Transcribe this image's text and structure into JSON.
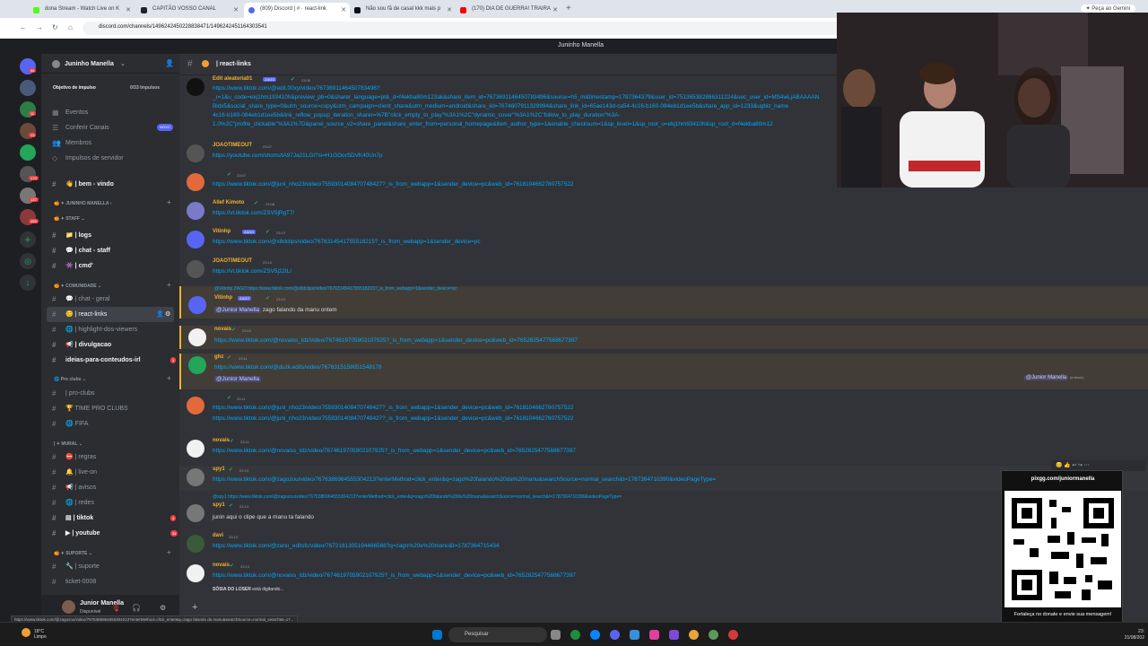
{
  "browser": {
    "tabs": [
      {
        "label": "dona Stream - Watch Live on K",
        "color": "#53fc18"
      },
      {
        "label": "CAPITÃO VOSSO CANAL",
        "color": "#222222"
      },
      {
        "label": "(809) Discord | # · react-link",
        "color": "#5865f2"
      },
      {
        "label": "Não sou fã de casal kkk mais p",
        "color": "#111111"
      },
      {
        "label": "(170) DIA DE GUERRA! TRAIRA",
        "color": "#ff0000"
      }
    ],
    "url": "discord.com/channels/1496242450228838471/1496242451164303541",
    "gemini_label": "Peça ao Gemini"
  },
  "window_title": "Juninho Manella",
  "sidebar": {
    "server_name": "Juninho Manella",
    "boost_label": "Objetivo de impulso",
    "boost_count": "0/33 Impulsos",
    "top_items": [
      {
        "label": "Eventos",
        "icon": "calendar-icon"
      },
      {
        "label": "Conferir Canais",
        "icon": "browse-icon",
        "badge": "NOVO"
      },
      {
        "label": "Membros",
        "icon": "members-icon"
      },
      {
        "label": "Impulsos de servidor",
        "icon": "boost-icon"
      }
    ],
    "categories": [
      "JUNINHO MANELLA",
      "STAFF",
      "COMUNIDADE",
      "Pro clubs",
      "MURAL",
      "SUPORTE"
    ],
    "channels": [
      "| bem - vindo",
      "| logs",
      "| chat - staff",
      "| cmd'",
      "| chat - geral",
      "| react-links",
      "| highlight-dos-viewers",
      "| divulgacao",
      "ideias-para-conteudos-irl",
      "| pro-clubs",
      "TIME PRO CLUBS",
      "FIFA",
      "| regras",
      "| live-on",
      "| avisos",
      "| redes",
      "| tiktok",
      "| youtube",
      "| suporte",
      "ticket-0008"
    ],
    "badges": {
      "ideias": "1",
      "tiktok": "1",
      "youtube": "11"
    }
  },
  "guild_badges": [
    "86",
    "11",
    "13",
    "179",
    "137",
    "459"
  ],
  "user": {
    "name": "Junior Manella",
    "status": "Disponível"
  },
  "channel": {
    "name": "| react-links"
  },
  "messages": [
    {
      "author": "Edit aleatoria01",
      "tag": "ZAGO",
      "time": "23:06",
      "color": "#f0b232",
      "lines": [
        "https://www.tiktok.com/@edit.00xy/video/7673691146450783496?",
        "_r=1&u_code=ekj1hm193410h&preview_pb=0&sharer_language=pt&_d=f4ekba80m123ak&share_item_id=7673691146450783496&source=h5_m&timestamp=1787364379&user_id=751365382886311224&sec_user_id=MS4wLjABAAAAN",
        "Bidx5&social_share_type=0&utm_source=copy&utm_campaign=client_share&utm_medium=android&share_iid=7674607911329994&share_link_id=65ae143d-ca54-4c16-b160-084eb1d1ee5b&share_app_id=1233&ugbiz_name",
        "4c16-b160-084eb1d1ee5b&link_reflow_popup_iteration_sharer=%7B\"click_empty_to_play\"%3A1%2C\"dynamic_cover\"%3A1%2C\"follow_to_play_duration\"%3A-",
        "1.0%2C\"profile_clickable\"%3A1%7D&panel_source_v2=share_panel&share_enter_from=personal_homepage&item_author_type=1&enable_checksum=1&sp_level=1&sp_root_u=ekj1hm93410h&sp_root_d=f4ekba80m12"
      ]
    },
    {
      "author": "JOAOTIMEOUT",
      "time": "23:07",
      "color": "#f0b232",
      "lines": [
        "https://youtube.com/shorts/tA97Ja21LGI?si=H1GOorSDVK40Un7p"
      ]
    },
    {
      "author": "",
      "time": "23:07",
      "color": "#dbdee1",
      "lines": [
        "https://www.tiktok.com/@juni_nho23/video/7559301408470748427?_is_from_webapp=1&sender_device=pc&web_id=7618104662780757522"
      ]
    },
    {
      "author": "Allef Kimoto",
      "time": "23:08",
      "color": "#f0b232",
      "lines": [
        "https://vt.tiktok.com/ZSV5jRgT7/"
      ]
    },
    {
      "author": "Vitinhp",
      "tag": "ZAGO",
      "time": "23:10",
      "color": "#f0b232",
      "lines": [
        "https://www.tiktok.com/@x8dclips/video/7676314541755518215?_is_from_webapp=1&sender_device=pc"
      ]
    },
    {
      "author": "JOAOTIMEOUT",
      "time": "23:10",
      "color": "#f0b232",
      "lines": [
        "https://vt.tiktok.com/ZSV5j22tL/"
      ]
    },
    {
      "author": "Vitinhp",
      "tag": "ZAGO",
      "time": "23:10",
      "color": "#f0b232",
      "reply": "@Vitinhp  ZAGO  https://www.tiktok.com/@x8dclips/video/7676314541755518215?_is_from_webapp=1&sender_device=pc",
      "mention": "@Junior Manella",
      "text": " zago falando da manu ontem"
    },
    {
      "author": "novais",
      "time": "23:10",
      "color": "#f0b232",
      "lines": [
        "https://www.tiktok.com/@novaiss_tdz/video/7674619705902107925?_is_from_webapp=1&sender_device=pc&web_id=7652825477568677397"
      ]
    },
    {
      "author": "ghz",
      "time": "23:11",
      "color": "#f0b232",
      "lines": [
        "https://www.tiktok.com/@duzk.edits/video/7676315159051548178"
      ],
      "mention": "@Junior Manella"
    },
    {
      "author": "",
      "time": "23:11",
      "color": "#dbdee1",
      "lines": [
        "https://www.tiktok.com/@juni_nho23/video/7559301408470748427?_is_from_webapp=1&sender_device=pc&web_id=7618104662780757522",
        "https://www.tiktok.com/@juni_nho23/video/7559301408470748427?_is_from_webapp=1&sender_device=pc&web_id=7618104662780757522"
      ]
    },
    {
      "author": "novais",
      "time": "23:11",
      "color": "#f0b232",
      "lines": [
        "https://www.tiktok.com/@novaiss_tdz/video/7674619705902107925?_is_from_webapp=1&sender_device=pc&web_id=7652825477568677397"
      ]
    },
    {
      "author": "spy1",
      "time": "23:13",
      "color": "#f0b232",
      "lines": [
        "https://www.tiktok.com/@zagozou/video/7676386964555304213?enterMethod=click_enter&q=zago%20falando%20da%20manu&searchSource=normal_search&t=1787364710390&videoPageType="
      ]
    },
    {
      "author": "spy1",
      "time": "23:13",
      "color": "#f0b232",
      "reply": "@spy1  https://www.tiktok.com/@zagozou/video/7676386964555304213?enterMethod=click_enter&q=zago%20falando%20da%20manu&searchSource=normal_search&t=1787364710390&videoPageType=",
      "text": "junin aqui o clipe que a manu ta falando"
    },
    {
      "author": "davi",
      "time": "23:13",
      "color": "#f0b232",
      "lines": [
        "https://www.tiktok.com/@zanu_editsfc/video/7672181305194466568?q=zago%20e%20manu&t=1787364715434"
      ]
    },
    {
      "author": "novais",
      "time": "23:13",
      "color": "#f0b232",
      "lines": [
        "https://www.tiktok.com/@novaiss_tdz/video/7674619705902107925?_is_from_webapp=1&sender_device=pc&web_id=7652825477568677397"
      ]
    }
  ],
  "mention_right": "@Junior Manella",
  "mention_right_note": "(editado)",
  "typing": {
    "name": "SÓSIA DO LOSER",
    "suffix": " está digitando..."
  },
  "qr": {
    "url": "pixgg.com/juniormanella",
    "caption": "Fortaleça no donate e envie sua mensagem!"
  },
  "status_url": "https://www.tiktok.com/@zagozou/video/7676386964555304213?enterMethod=click_enter&q=zago falando da manu&searchSource=normal_search&t=17...",
  "taskbar": {
    "search_placeholder": "Pesquisar",
    "temp": "18°C",
    "weather": "Limpo",
    "time": "23:",
    "date": "21/08/202"
  }
}
